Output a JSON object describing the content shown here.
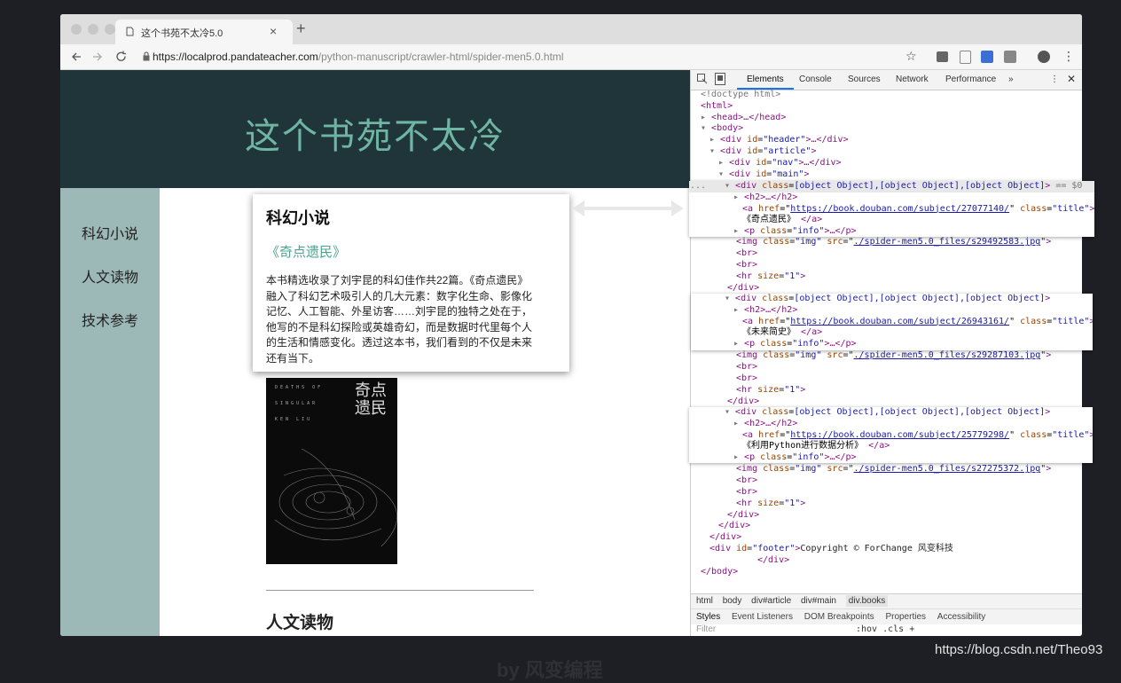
{
  "browser": {
    "tab_title": "这个书苑不太冷5.0",
    "new_tab": "+",
    "close_tab": "×",
    "url_host": "https://localprod.pandateacher.com",
    "url_path": "/python-manuscript/crawler-html/spider-men5.0.html"
  },
  "page": {
    "site_title": "这个书苑不太冷",
    "nav": [
      "科幻小说",
      "人文读物",
      "技术参考"
    ],
    "next_section_title": "人文读物"
  },
  "card": {
    "section_title": "科幻小说",
    "book_title": "《奇点遗民》",
    "description": "本书精选收录了刘宇昆的科幻佳作共22篇。《奇点遗民》融入了科幻艺术吸引人的几大元素：数字化生命、影像化记忆、人工智能、外星访客……刘宇昆的独特之处在于，他写的不是科幻探险或英雄奇幻，而是数据时代里每个人的生活和情感变化。透过这本书，我们看到的不仅是未来还有当下。"
  },
  "cover": {
    "title_line1": "奇点",
    "title_line2": "遗民"
  },
  "devtools": {
    "tabs": [
      "Elements",
      "Console",
      "Sources",
      "Network",
      "Performance",
      "»"
    ],
    "breadcrumb": [
      "html",
      "body",
      "div#article",
      "div#main",
      "div.books"
    ],
    "styles_tabs": [
      "Styles",
      "Event Listeners",
      "DOM Breakpoints",
      "Properties",
      "Accessibility"
    ],
    "filter_placeholder": "Filter",
    "filter_tools": ":hov  .cls  +",
    "selected_marker": "== $0",
    "ellipsis": "...",
    "code": {
      "doctype": "<!doctype html>",
      "html_open": "<html>",
      "head": "<head>…</head>",
      "body_open": "<body>",
      "div": "div",
      "id": "id",
      "class": "class",
      "header": "\"header\"",
      "article": "\"article\"",
      "nav": "\"nav\"",
      "main": "\"main\"",
      "books": [
        {
          "href": "https://book.douban.com/subject/27077140/",
          "text": "《奇点遗民》",
          "src": "./spider-men5.0_files/s29492583.jpg"
        },
        {
          "href": "https://book.douban.com/subject/26943161/",
          "text": "《未来简史》",
          "src": "./spider-men5.0_files/s29287103.jpg"
        },
        {
          "href": "https://book.douban.com/subject/25779298/",
          "text": "《利用Python进行数据分析》",
          "src": "./spider-men5.0_files/s27275372.jpg"
        }
      ],
      "h2": "<h2>…</h2>",
      "a": "a",
      "href": "href",
      "title": "\"title\"",
      "info": "\"info\"",
      "img": "img",
      "img_class": "\"img\"",
      "src": "src",
      "br": "<br>",
      "hr": "hr",
      "size": "size",
      "size_val": "\"1\"",
      "div_close": "</div>",
      "a_close": "</a>",
      "p": "p",
      "p_close": "…</p>",
      "collapsed": "…</div>",
      "footer": "\"footer\"",
      "footer_text": "Copyright © ForChange 风变科技",
      "body_close": "</body>"
    }
  },
  "footer_ghost": "by 风变编程",
  "watermark": "https://blog.csdn.net/Theo93"
}
